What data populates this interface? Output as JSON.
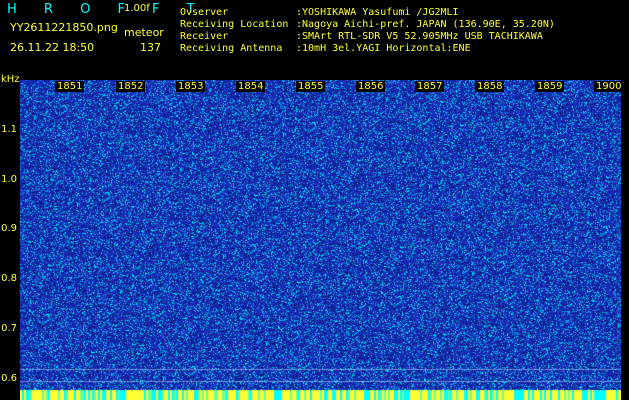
{
  "app": {
    "brand": "H R O F F T",
    "version": "1.00f",
    "filename": "YY2611221850.png",
    "datetime": "26.11.22 18:50",
    "meteor_label": "meteor",
    "meteor_count": "137"
  },
  "info": [
    {
      "label": "Ovserver",
      "value": ":YOSHIKAWA Yasufumi /JG2MLI"
    },
    {
      "label": "Receiving Location",
      "value": ":Nagoya Aichi-pref. JAPAN (136.90E, 35.20N)"
    },
    {
      "label": "Receiver",
      "value": ":SMArt RTL-SDR V5 52.905MHz USB TACHIKAWA"
    },
    {
      "label": "Receiving Antenna",
      "value": ":10mH 3el.YAGI Horizontal:ENE"
    }
  ],
  "axis": {
    "y_unit": "kHz",
    "y_ticks": [
      "1.1",
      "1.0",
      "0.9",
      "0.8",
      "0.7",
      "0.6"
    ],
    "x_ticks": [
      "1851",
      "1852",
      "1853",
      "1854",
      "1855",
      "1856",
      "1857",
      "1858",
      "1859",
      "1900"
    ]
  },
  "colors": {
    "background": "#000000",
    "text": "#ffff33",
    "brand": "#00ffff",
    "spectrogram_base": "#1c2fbf",
    "noise_cyan": "#00e5ff",
    "noise_dark": "#0a1c80"
  }
}
